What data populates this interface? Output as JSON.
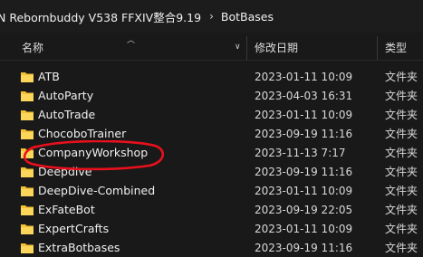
{
  "breadcrumb": {
    "segments": [
      "N Rebornbuddy V538 FFXIV整合9.19",
      "BotBases"
    ],
    "separator": "›"
  },
  "columns": {
    "name": "名称",
    "date_modified": "修改日期",
    "type": "类型"
  },
  "rows": [
    {
      "name": "ATB",
      "date": "2023-01-11 10:09",
      "type": "文件夹"
    },
    {
      "name": "AutoParty",
      "date": "2023-04-03 16:31",
      "type": "文件夹"
    },
    {
      "name": "AutoTrade",
      "date": "2023-01-11 10:09",
      "type": "文件夹"
    },
    {
      "name": "ChocoboTrainer",
      "date": "2023-09-19 11:16",
      "type": "文件夹"
    },
    {
      "name": "CompanyWorkshop",
      "date": "2023-11-13 7:17",
      "type": "文件夹"
    },
    {
      "name": "Deepdive",
      "date": "2023-09-19 11:16",
      "type": "文件夹"
    },
    {
      "name": "DeepDive-Combined",
      "date": "2023-01-11 10:09",
      "type": "文件夹"
    },
    {
      "name": "ExFateBot",
      "date": "2023-09-19 22:05",
      "type": "文件夹"
    },
    {
      "name": "ExpertCrafts",
      "date": "2023-01-11 10:09",
      "type": "文件夹"
    },
    {
      "name": "ExtraBotbases",
      "date": "2023-09-19 11:16",
      "type": "文件夹"
    }
  ],
  "icons": {
    "folder": "folder-icon",
    "sort": "sort-up-icon",
    "chevron": "chevron-down-icon"
  },
  "colors": {
    "background": "#191919",
    "folder": "#f5c236",
    "highlight_annotation": "#e8101c"
  }
}
